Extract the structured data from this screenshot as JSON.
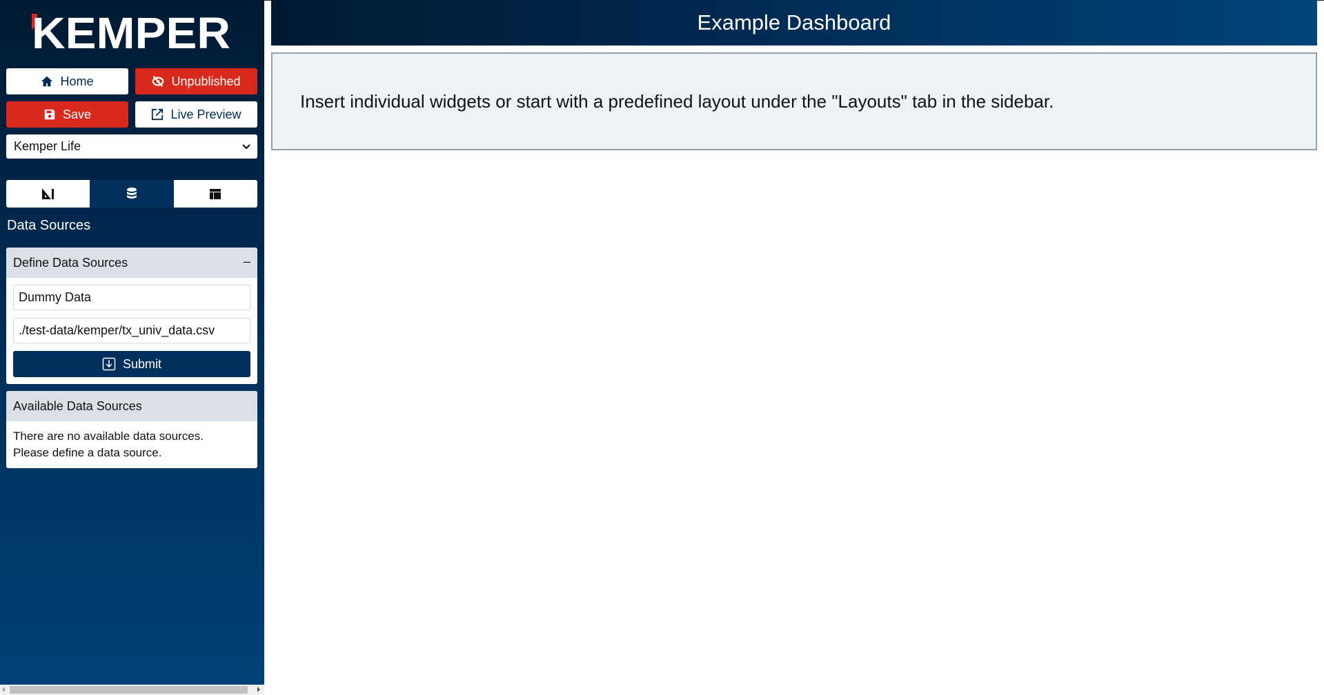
{
  "brand": {
    "logo_text": "KEMPER",
    "accent": "#d9291c",
    "navy": "#002f5c"
  },
  "sidebar": {
    "buttons": {
      "home": "Home",
      "unpublished": "Unpublished",
      "save": "Save",
      "live_preview": "Live Preview"
    },
    "select": {
      "value": "Kemper Life"
    },
    "tabs": [
      {
        "icon": "design-tools-icon"
      },
      {
        "icon": "database-icon",
        "active": true
      },
      {
        "icon": "layout-icon"
      }
    ],
    "section_title": "Data Sources",
    "define_panel": {
      "title": "Define Data Sources",
      "collapse": "–",
      "name_value": "Dummy Data",
      "path_value": "./test-data/kemper/tx_univ_data.csv",
      "submit": "Submit"
    },
    "available_panel": {
      "title": "Available Data Sources",
      "line1": "There are no available data sources.",
      "line2": "Please define a data source."
    }
  },
  "main": {
    "title": "Example Dashboard",
    "info": "Insert individual widgets or start with a predefined layout under the \"Layouts\" tab in the sidebar."
  }
}
